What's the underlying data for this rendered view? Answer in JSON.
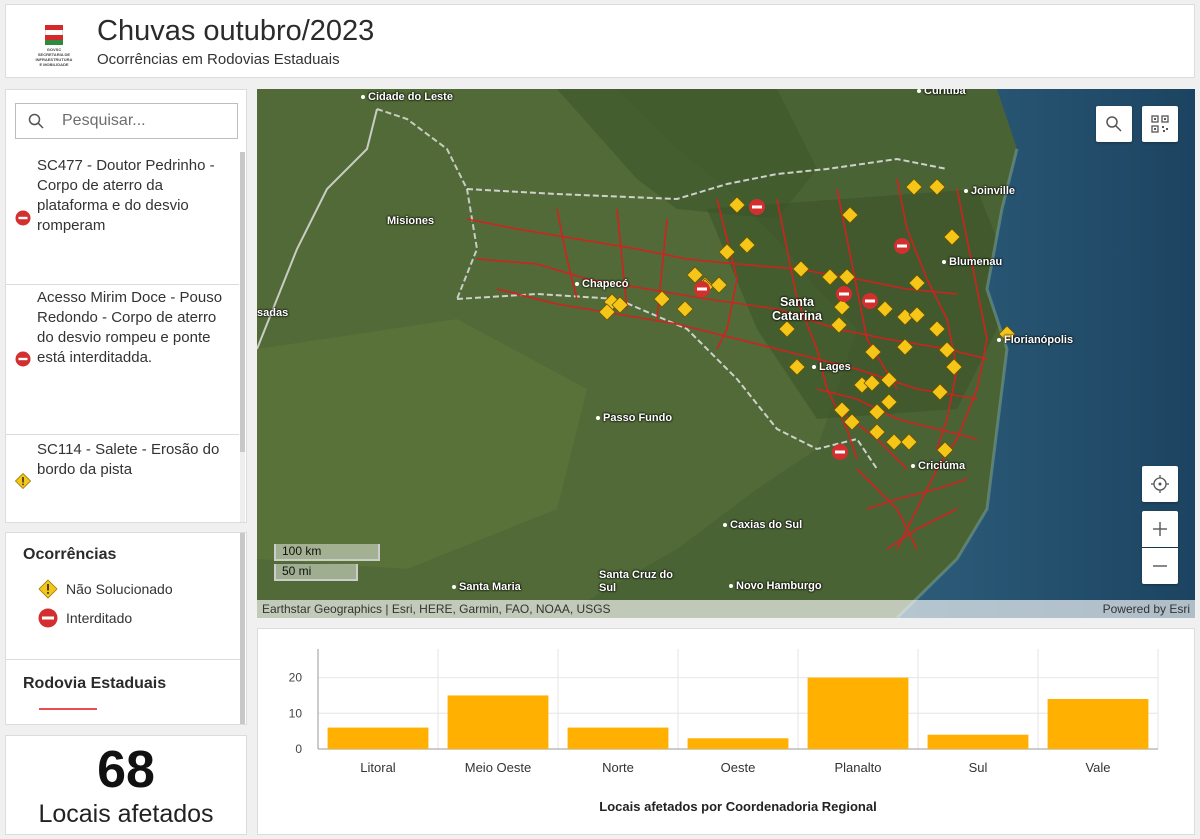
{
  "header": {
    "title": "Chuvas outubro/2023",
    "subtitle": "Ocorrências em Rodovias Estaduais",
    "logo_text": "GOVSC SECRETARIA DE INFRAESTRUTURA E MOBILIDADE"
  },
  "search": {
    "placeholder": "Pesquisar..."
  },
  "list": {
    "items": [
      {
        "title": "SC477 - Doutor Pedrinho - Corpo de aterro da plataforma e do desvio romperam",
        "status": "interditado"
      },
      {
        "title": "Acesso Mirim Doce - Pouso Redondo - Corpo de aterro do desvio rompeu e ponte está interditadda.",
        "status": "interditado"
      },
      {
        "title": "SC114 - Salete - Erosão do bordo da pista",
        "status": "nao_solucionado"
      }
    ]
  },
  "legend": {
    "title": "Ocorrências",
    "items": [
      {
        "label": "Não Solucionado",
        "icon": "warning-diamond-icon",
        "color": "#f5c518"
      },
      {
        "label": "Interditado",
        "icon": "no-entry-icon",
        "color": "#d32f2f"
      }
    ],
    "roads_title": "Rodovia Estaduais",
    "roads_color": "#e85050"
  },
  "kpi": {
    "value": "68",
    "label": "Locais afetados"
  },
  "map": {
    "cities": [
      {
        "name": "Cidade do Leste"
      },
      {
        "name": "Curitiba"
      },
      {
        "name": "Joinville"
      },
      {
        "name": "Misiones"
      },
      {
        "name": "Blumenau"
      },
      {
        "name": "Chapecó"
      },
      {
        "name": "Santa Catarina"
      },
      {
        "name": "Florianópolis"
      },
      {
        "name": "Lages"
      },
      {
        "name": "Passo Fundo"
      },
      {
        "name": "Criciúma"
      },
      {
        "name": "Caxias do Sul"
      },
      {
        "name": "Santa Maria"
      },
      {
        "name": "Santa Cruz do Sul"
      },
      {
        "name": "Novo Hamburgo"
      },
      {
        "name": "sadas"
      }
    ],
    "scale_km": "100 km",
    "scale_mi": "50 mi",
    "attribution": "Earthstar Geographics | Esri, HERE, Garmin, FAO, NOAA, USGS",
    "powered_by": "Powered by Esri"
  },
  "chart_data": {
    "type": "bar",
    "categories": [
      "Litoral",
      "Meio Oeste",
      "Norte",
      "Oeste",
      "Planalto",
      "Sul",
      "Vale"
    ],
    "values": [
      6,
      15,
      6,
      3,
      20,
      4,
      14
    ],
    "title": "",
    "xlabel": "Locais afetados por Coordenadoria Regional",
    "ylabel": "",
    "ylim": [
      0,
      28
    ],
    "yticks": [
      0,
      10,
      20
    ],
    "grid": true,
    "color": "#ffb000"
  }
}
